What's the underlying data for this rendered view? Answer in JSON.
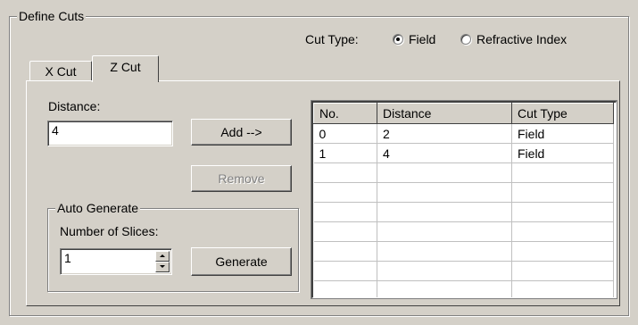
{
  "define_cuts": {
    "title": "Define Cuts",
    "cut_type": {
      "label": "Cut Type:",
      "options": [
        {
          "label": "Field",
          "selected": true
        },
        {
          "label": "Refractive Index",
          "selected": false
        }
      ]
    },
    "tabs": [
      {
        "label": "X Cut",
        "active": false
      },
      {
        "label": "Z Cut",
        "active": true
      }
    ],
    "distance": {
      "label": "Distance:",
      "value": "4"
    },
    "add_button": "Add -->",
    "remove_button": "Remove",
    "auto_generate": {
      "title": "Auto Generate",
      "slices_label": "Number of Slices:",
      "slices_value": "1",
      "generate_button": "Generate"
    },
    "table": {
      "columns": [
        "No.",
        "Distance",
        "Cut Type"
      ],
      "rows": [
        [
          "0",
          "2",
          "Field"
        ],
        [
          "1",
          "4",
          "Field"
        ]
      ]
    }
  }
}
